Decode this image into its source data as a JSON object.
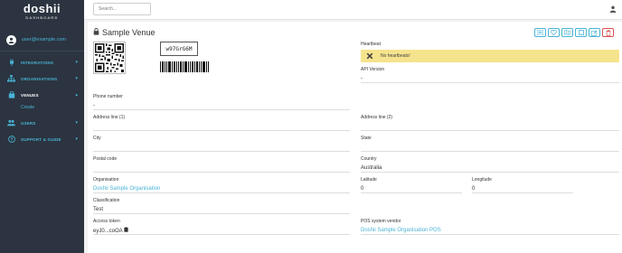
{
  "sidebar": {
    "logo": "doshii",
    "logo_sub": "DASHBOARD",
    "user_email": "user@example.com",
    "items": [
      {
        "label": "INTEGRATIONS",
        "icon": "plug-icon"
      },
      {
        "label": "ORGANISATIONS",
        "icon": "org-chart-icon"
      },
      {
        "label": "VENUES",
        "icon": "shopping-bag-icon"
      },
      {
        "label": "USERS",
        "icon": "users-icon"
      },
      {
        "label": "SUPPORT & GUIDE",
        "icon": "help-circle-icon"
      }
    ],
    "venues_sub": "Create"
  },
  "topbar": {
    "search_placeholder": "Search..."
  },
  "venue": {
    "title": "Sample Venue",
    "code": "w97GrG6M",
    "heartbeat_label": "Heartbeat",
    "heartbeat_message": "No heartbeats!",
    "api_version_label": "API Version",
    "api_version": "-",
    "phone_label": "Phone number",
    "phone": "-",
    "address1_label": "Address line (1)",
    "address1": "",
    "address2_label": "Address line (2)",
    "address2": "",
    "city_label": "City",
    "city": "",
    "state_label": "State",
    "state": "",
    "postal_label": "Postal code",
    "postal": "",
    "country_label": "Country",
    "country": "Australia",
    "org_label": "Organisation",
    "org": "Doshii Sample Organisation",
    "lat_label": "Latitude",
    "lat": "0",
    "lng_label": "Longitude",
    "lng": "0",
    "class_label": "Classification",
    "classification": "Test",
    "token_label": "Access token",
    "token": "eyJ0...coOA",
    "pos_label": "POS system vendor",
    "pos": "Doshii Sample Organisation POS"
  },
  "colors": {
    "sidebar_bg": "#2b3440",
    "accent": "#4ab3d6",
    "warning_bg": "#f6e38d",
    "danger": "#d9534f"
  }
}
